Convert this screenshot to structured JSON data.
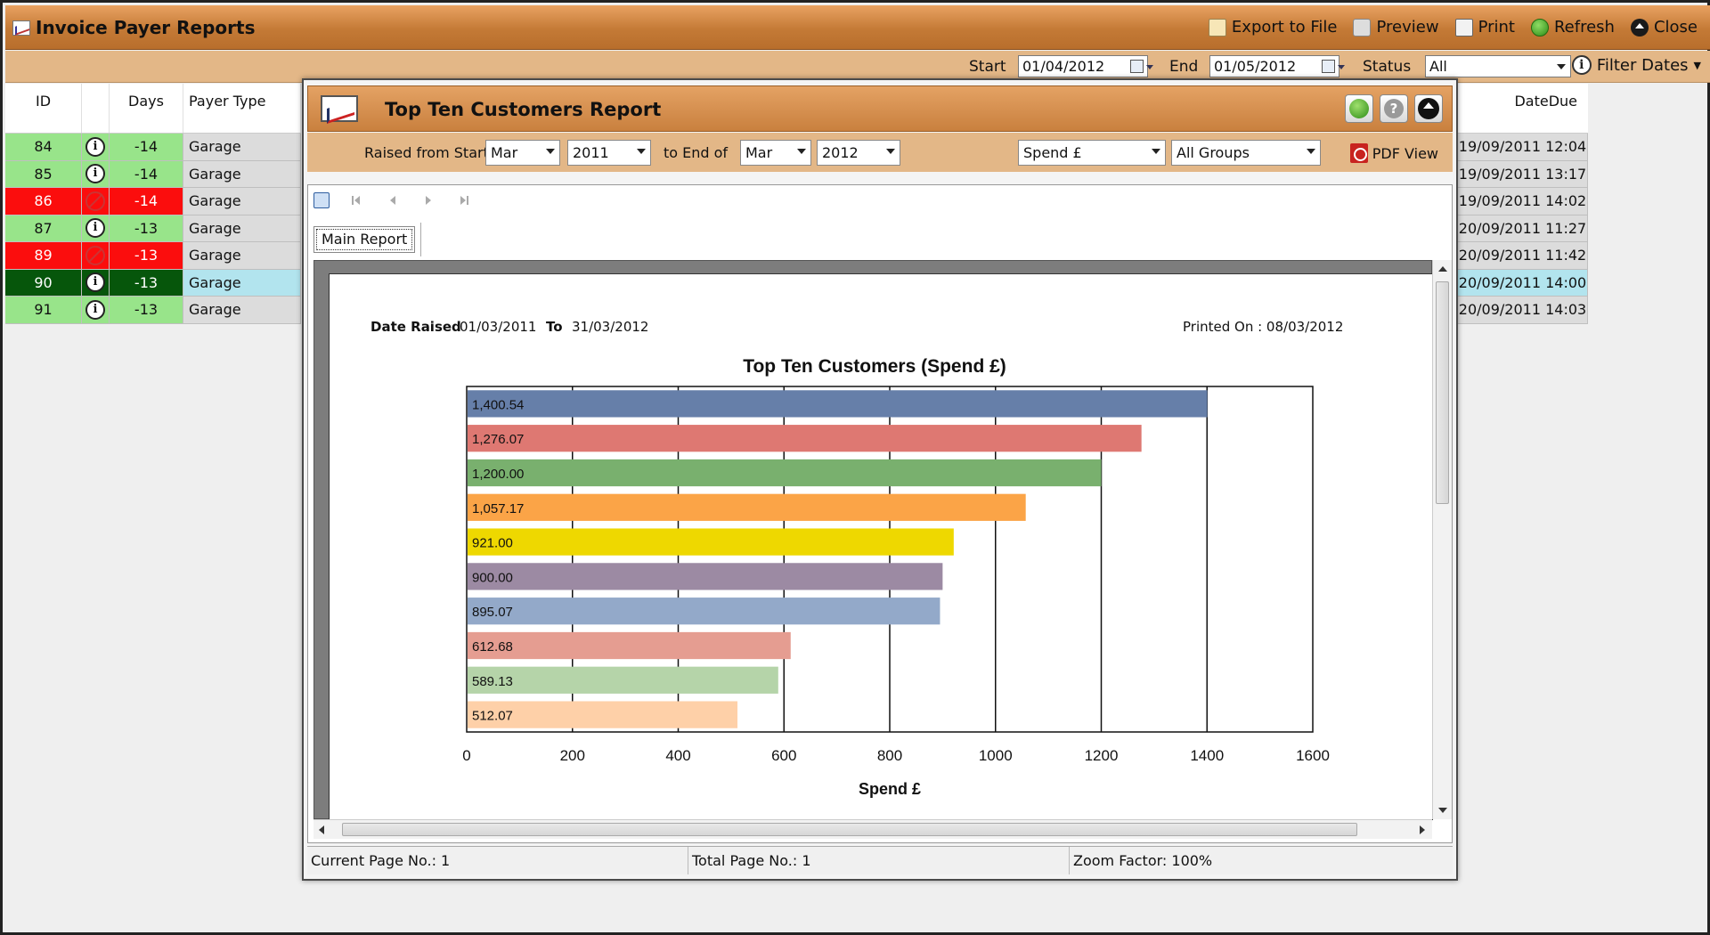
{
  "app": {
    "title": "Invoice Payer Reports",
    "actions": [
      {
        "label": "Export to File",
        "icon": "export-icon"
      },
      {
        "label": "Preview",
        "icon": "preview-icon"
      },
      {
        "label": "Print",
        "icon": "print-icon"
      },
      {
        "label": "Refresh",
        "icon": "refresh-icon"
      },
      {
        "label": "Close",
        "icon": "close-icon"
      }
    ]
  },
  "filters": {
    "start_label": "Start",
    "start_value": "01/04/2012",
    "end_label": "End",
    "end_value": "01/05/2012",
    "status_label": "Status",
    "status_value": "All",
    "filter_dates_label": "Filter Dates"
  },
  "grid": {
    "headers": {
      "id": "ID",
      "days": "Days",
      "payer_type": "Payer Type",
      "date_due": "DateDue"
    },
    "rows": [
      {
        "id": "84",
        "days": "-14",
        "type": "Garage",
        "due": "19/09/2011 12:04",
        "status": "ok"
      },
      {
        "id": "85",
        "days": "-14",
        "type": "Garage",
        "due": "19/09/2011 13:17",
        "status": "ok"
      },
      {
        "id": "86",
        "days": "-14",
        "type": "Garage",
        "due": "19/09/2011 14:02",
        "status": "bad"
      },
      {
        "id": "87",
        "days": "-13",
        "type": "Garage",
        "due": "20/09/2011 11:27",
        "status": "ok"
      },
      {
        "id": "89",
        "days": "-13",
        "type": "Garage",
        "due": "20/09/2011 11:42",
        "status": "bad"
      },
      {
        "id": "90",
        "days": "-13",
        "type": "Garage",
        "due": "20/09/2011 14:00",
        "status": "selected"
      },
      {
        "id": "91",
        "days": "-13",
        "type": "Garage",
        "due": "20/09/2011 14:03",
        "status": "ok"
      }
    ]
  },
  "dialog": {
    "title": "Top Ten Customers  Report",
    "raised_from_label": "Raised from Start of",
    "from_month": "Mar",
    "from_year": "2011",
    "to_end_label": "to End of",
    "to_month": "Mar",
    "to_year": "2012",
    "measure": "Spend £",
    "group": "All  Groups",
    "pdf_view_label": "PDF View",
    "tab_label": "Main Report",
    "report": {
      "date_raised_label": "Date Raised",
      "date_from": "01/03/2011",
      "to_label": "To",
      "date_to": "31/03/2012",
      "printed_on": "Printed On : 08/03/2012"
    },
    "status": {
      "current_page": "Current Page No.: 1",
      "total_pages": "Total Page No.: 1",
      "zoom": "Zoom Factor: 100%"
    }
  },
  "chart_data": {
    "type": "bar",
    "orientation": "horizontal",
    "title": "Top Ten Customers (Spend £)",
    "xlabel": "Spend £",
    "ylabel": "",
    "xlim": [
      0,
      1600
    ],
    "xticks": [
      0,
      200,
      400,
      600,
      800,
      1000,
      1200,
      1400,
      1600
    ],
    "grid": true,
    "values": [
      1400.54,
      1276.07,
      1200.0,
      1057.17,
      921.0,
      900.0,
      895.07,
      612.68,
      589.13,
      512.07
    ],
    "labels": [
      "1,400.54",
      "1,276.07",
      "1,200.00",
      "1,057.17",
      "921.00",
      "900.00",
      "895.07",
      "612.68",
      "589.13",
      "512.07"
    ],
    "colors": [
      "#667fa9",
      "#de7872",
      "#79b06e",
      "#fba447",
      "#eed800",
      "#9c8aa3",
      "#93a9c9",
      "#e59d91",
      "#b5d4a9",
      "#fed0a8"
    ]
  }
}
